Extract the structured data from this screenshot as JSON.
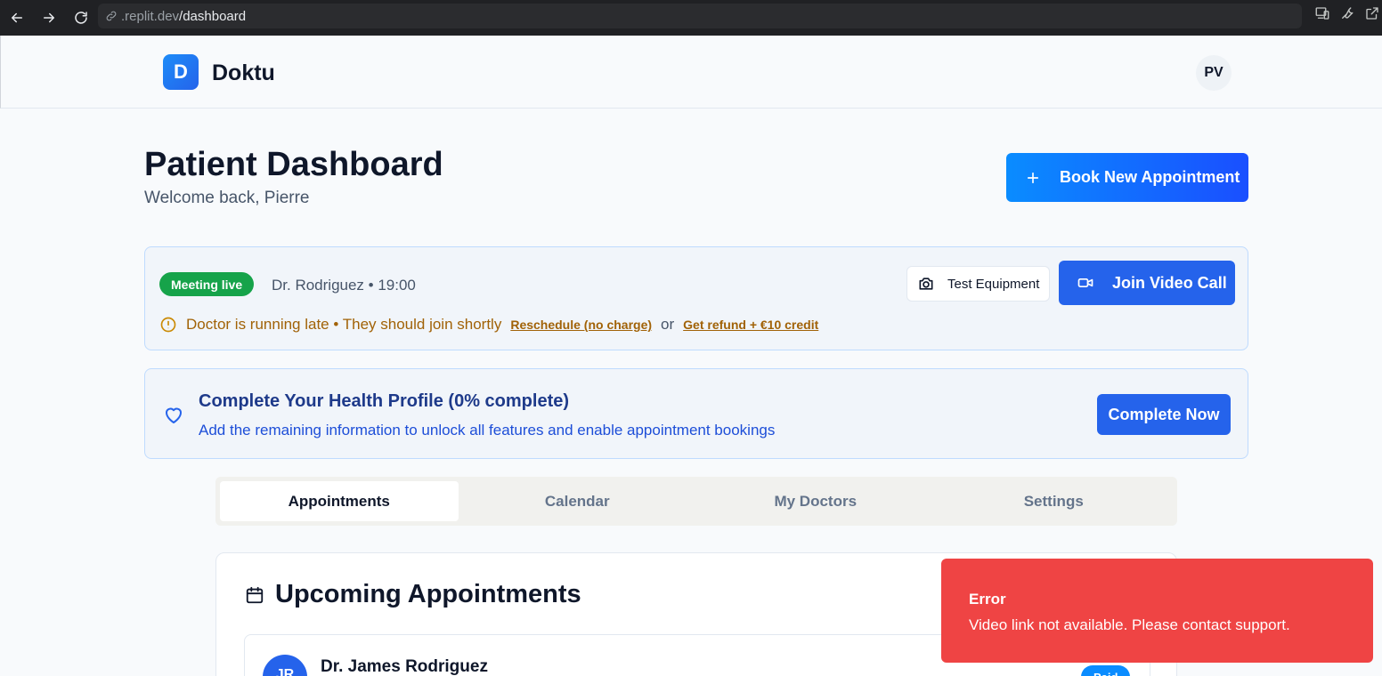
{
  "browser": {
    "url_host": ".replit.dev",
    "url_path": "/dashboard"
  },
  "header": {
    "logo_letter": "D",
    "brand": "Doktu",
    "user_initials": "PV"
  },
  "page": {
    "title": "Patient Dashboard",
    "welcome": "Welcome back, Pierre",
    "book_button": "Book New Appointment"
  },
  "live_meeting": {
    "badge": "Meeting live",
    "info": "Dr. Rodriguez • 19:00",
    "test_button": "Test Equipment",
    "join_button": "Join Video Call",
    "late_notice": "Doctor is running late • They should join shortly",
    "reschedule_link": "Reschedule (no charge)",
    "or_text": "or",
    "refund_link": "Get refund + €10 credit"
  },
  "health_profile": {
    "title": "Complete Your Health Profile (0% complete)",
    "subtitle": "Add the remaining information to unlock all features and enable appointment bookings",
    "button": "Complete Now"
  },
  "tabs": [
    {
      "label": "Appointments",
      "active": true
    },
    {
      "label": "Calendar",
      "active": false
    },
    {
      "label": "My Doctors",
      "active": false
    },
    {
      "label": "Settings",
      "active": false
    }
  ],
  "appointments": {
    "title": "Upcoming Appointments",
    "items": [
      {
        "initials": "JR",
        "doctor": "Dr. James Rodriguez",
        "status": "Paid"
      }
    ]
  },
  "toast": {
    "title": "Error",
    "message": "Video link not available. Please contact support."
  },
  "colors": {
    "primary": "#2563eb",
    "live": "#16a34a",
    "warning": "#a16207",
    "error": "#ef4444"
  }
}
